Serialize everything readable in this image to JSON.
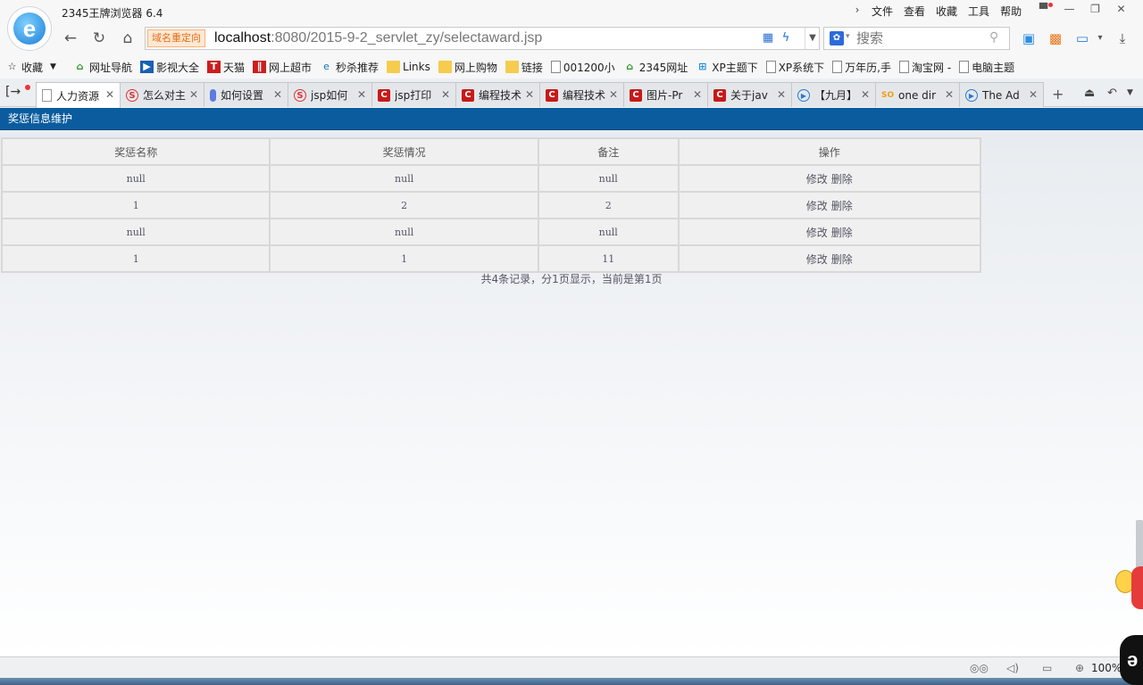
{
  "window": {
    "app_title": "2345王牌浏览器 6.4",
    "menu": [
      "文件",
      "查看",
      "收藏",
      "工具",
      "帮助"
    ]
  },
  "address": {
    "redirect_tag": "域名重定向",
    "url_host": "localhost",
    "url_rest": ":8080/2015-9-2_servlet_zy/selectaward.jsp"
  },
  "search": {
    "placeholder": "搜索"
  },
  "bookmarks": {
    "favorites": "收藏",
    "items": [
      "网址导航",
      "影视大全",
      "天猫",
      "网上超市",
      "秒杀推荐",
      "Links",
      "网上购物",
      "链接",
      "001200小",
      "2345网址",
      "XP主题下",
      "XP系统下",
      "万年历,手",
      "淘宝网 -",
      "电脑主题"
    ]
  },
  "tabs": [
    {
      "label": "人力资源",
      "icon": "page-icon"
    },
    {
      "label": "怎么对主",
      "icon": "sogou-icon"
    },
    {
      "label": "如何设置",
      "icon": "pen-icon"
    },
    {
      "label": "jsp如何",
      "icon": "sogou-icon"
    },
    {
      "label": "jsp打印",
      "icon": "csdn-icon"
    },
    {
      "label": "编程技术",
      "icon": "csdn-icon"
    },
    {
      "label": "编程技术",
      "icon": "csdn-icon"
    },
    {
      "label": "图片-Pr",
      "icon": "csdn-icon"
    },
    {
      "label": "关于jav",
      "icon": "csdn-icon"
    },
    {
      "label": "【九月】",
      "icon": "video-icon"
    },
    {
      "label": "one dir",
      "icon": "soku-icon"
    },
    {
      "label": "The Ad",
      "icon": "video-icon"
    }
  ],
  "page": {
    "header": "奖惩信息维护",
    "columns": [
      "奖惩名称",
      "奖惩情况",
      "备注",
      "操作"
    ],
    "rows": [
      {
        "name": "null",
        "situation": "null",
        "remark": "null"
      },
      {
        "name": "1",
        "situation": "2",
        "remark": "2"
      },
      {
        "name": "null",
        "situation": "null",
        "remark": "null"
      },
      {
        "name": "1",
        "situation": "1",
        "remark": "11"
      }
    ],
    "edit_label": "修改",
    "delete_label": "删除",
    "pagination": "共4条记录，分1页显示，当前是第1页"
  },
  "status": {
    "zoom": "100%"
  }
}
